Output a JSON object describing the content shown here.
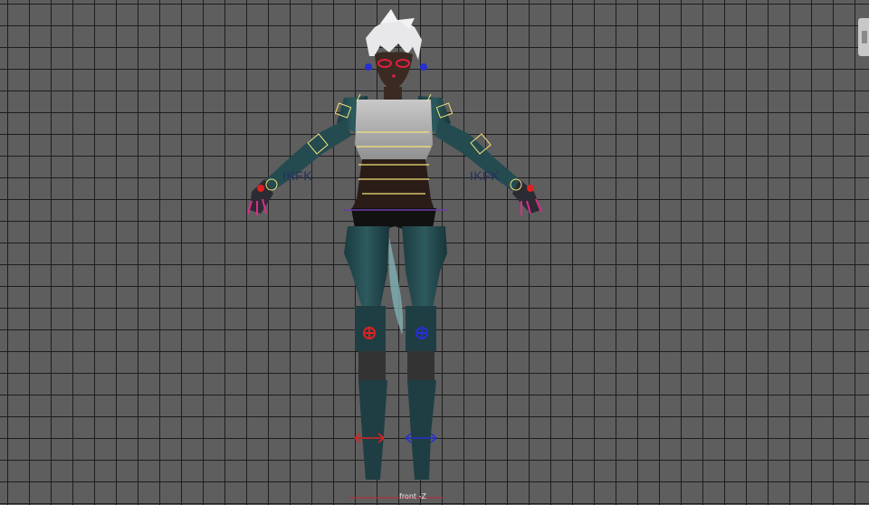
{
  "viewport": {
    "camera_label": "front -Z",
    "background_color": "#5e5e5e",
    "grid_color": "#1e1e1e"
  },
  "rig": {
    "left_arm_switch_label": "IKFK",
    "right_arm_switch_label": "IKFK",
    "control_colors": {
      "yellow": "#f4e37a",
      "red": "#e02020",
      "blue": "#2630d0",
      "magenta": "#d21a7a",
      "purple": "#6a3aa8"
    }
  },
  "icons": {
    "panel_toggle": "side-panel-grip-icon",
    "left_knee_control": "knee-pole-target-icon",
    "right_knee_control": "knee-pole-target-icon",
    "left_foot_control": "foot-ik-arrows-icon",
    "right_foot_control": "foot-ik-arrows-icon"
  }
}
